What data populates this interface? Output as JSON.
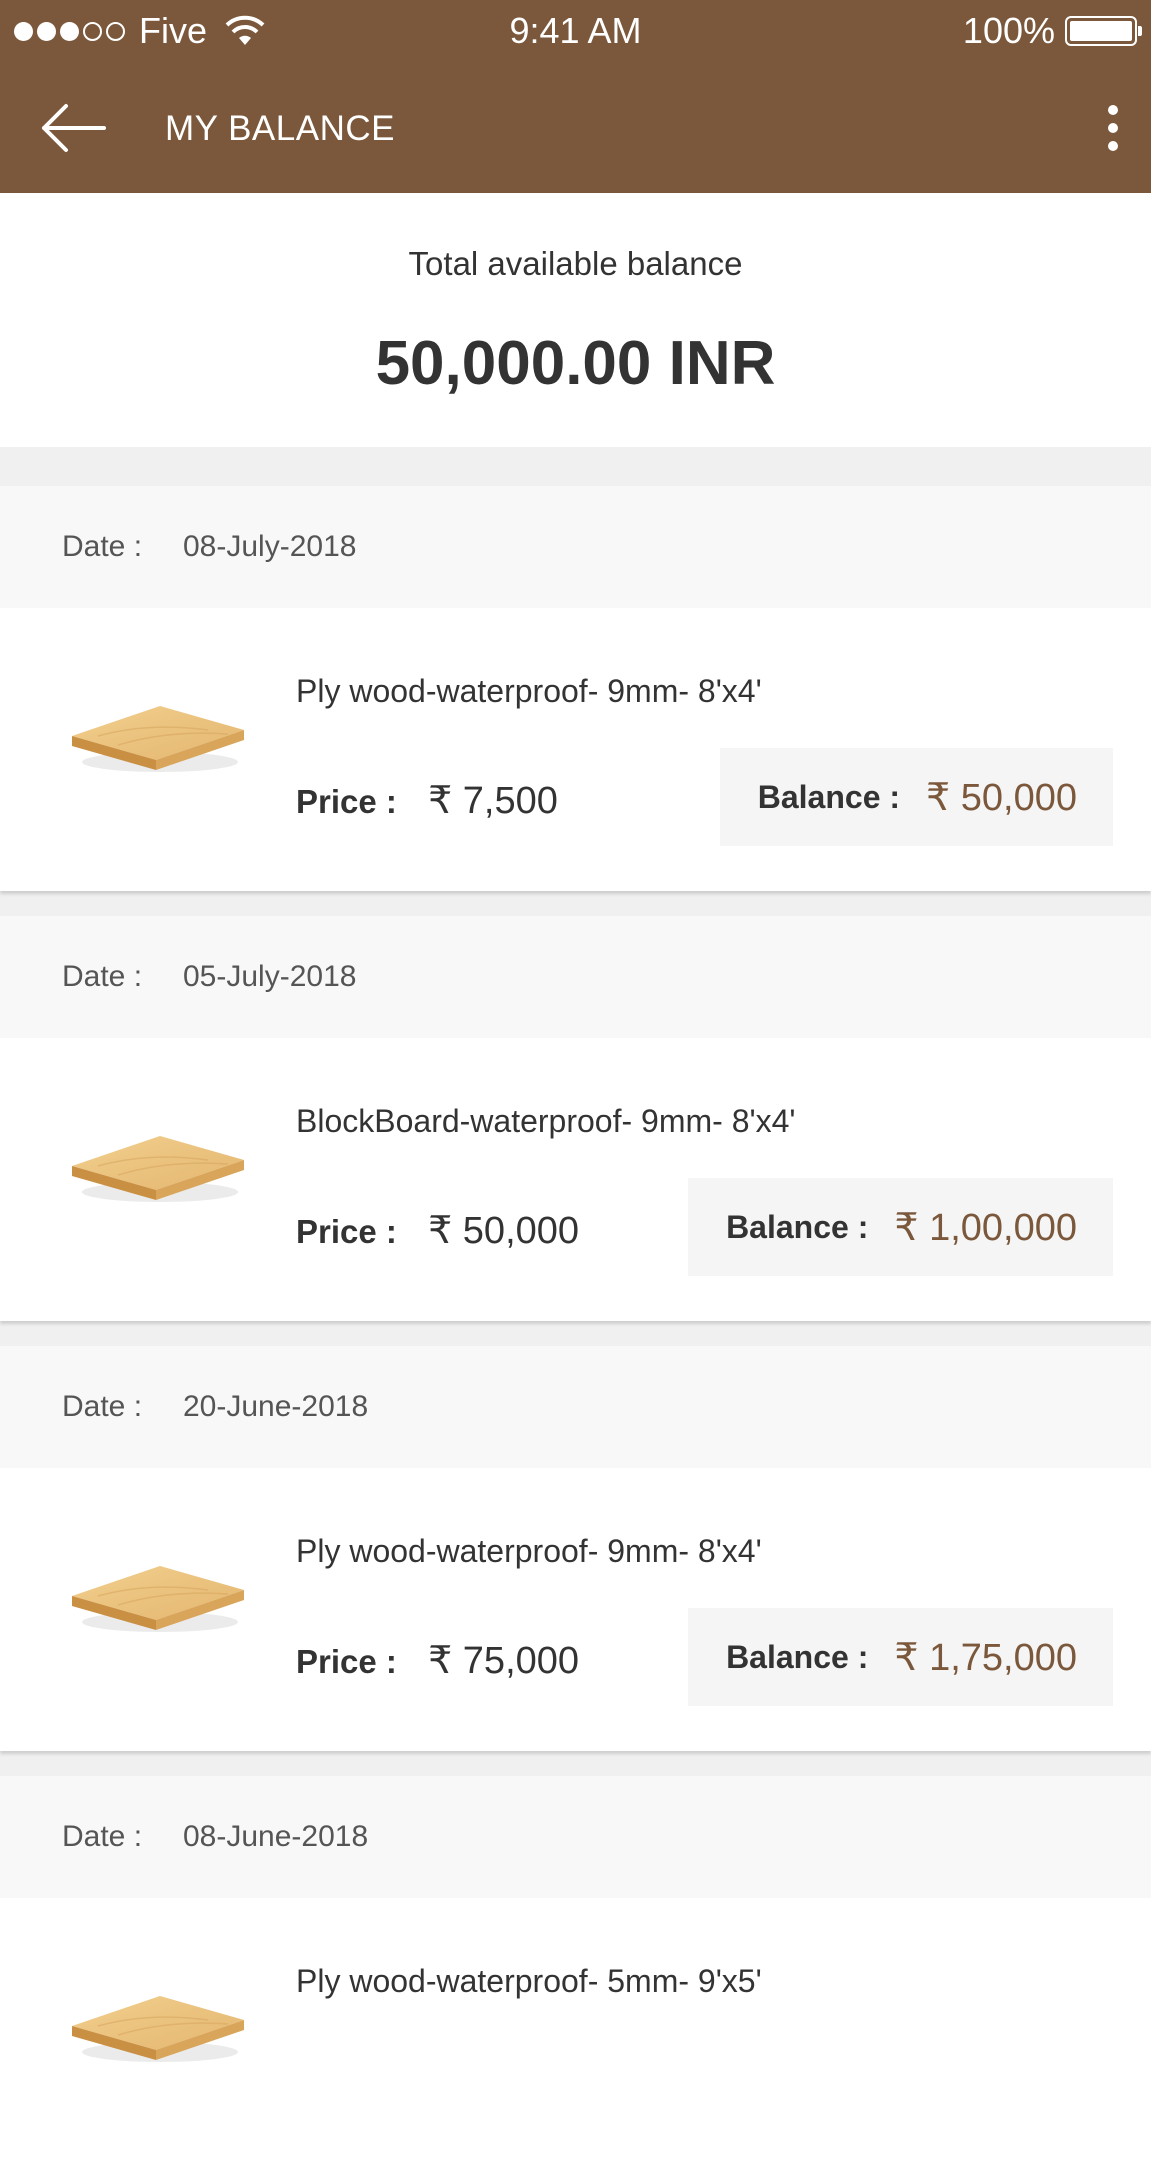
{
  "status_bar": {
    "carrier": "Five",
    "time": "9:41 AM",
    "battery": "100%"
  },
  "toolbar": {
    "title": "MY BALANCE"
  },
  "summary": {
    "label": "Total available balance",
    "amount": "50,000.00 INR"
  },
  "labels": {
    "date": "Date :",
    "price": "Price :",
    "balance": "Balance :"
  },
  "colors": {
    "brand": "#7b583b"
  },
  "transactions": [
    {
      "date": "08-July-2018",
      "product": "Ply wood-waterproof- 9mm- 8'x4'",
      "price": "₹ 7,500",
      "balance": "₹ 50,000"
    },
    {
      "date": "05-July-2018",
      "product": "BlockBoard-waterproof- 9mm- 8'x4'",
      "price": "₹ 50,000",
      "balance": "₹ 1,00,000"
    },
    {
      "date": "20-June-2018",
      "product": "Ply wood-waterproof- 9mm- 8'x4'",
      "price": "₹ 75,000",
      "balance": "₹ 1,75,000"
    },
    {
      "date": "08-June-2018",
      "product": "Ply wood-waterproof- 5mm- 9'x5'",
      "price": "",
      "balance": ""
    }
  ]
}
